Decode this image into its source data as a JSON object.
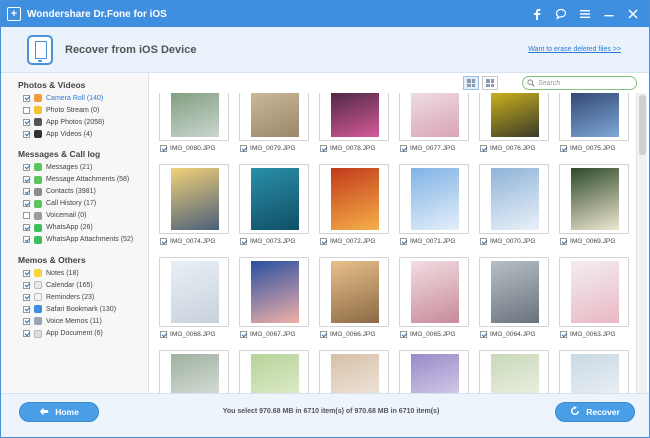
{
  "window": {
    "title": "Wondershare Dr.Fone for iOS"
  },
  "header": {
    "title": "Recover from iOS Device",
    "erase_link": "Want to erase deleted files >>"
  },
  "search": {
    "placeholder": "Search"
  },
  "sidebar": {
    "groups": [
      {
        "title": "Photos & Videos",
        "items": [
          {
            "label": "Camera Roll (140)",
            "checked": true,
            "active": true,
            "icon": "camera-roll-icon",
            "color": "#f39c3c"
          },
          {
            "label": "Photo Stream (0)",
            "checked": false,
            "icon": "photo-stream-icon",
            "color": "#f1c232"
          },
          {
            "label": "App Photos (2058)",
            "checked": true,
            "icon": "app-photos-icon",
            "color": "#555555"
          },
          {
            "label": "App Videos (4)",
            "checked": true,
            "icon": "app-videos-icon",
            "color": "#333333"
          }
        ]
      },
      {
        "title": "Messages & Call log",
        "items": [
          {
            "label": "Messages (21)",
            "checked": true,
            "icon": "messages-icon",
            "color": "#5cc45c"
          },
          {
            "label": "Message Attachments (58)",
            "checked": true,
            "icon": "message-attachments-icon",
            "color": "#5cc45c"
          },
          {
            "label": "Contacts (3981)",
            "checked": true,
            "icon": "contacts-icon",
            "color": "#8c8c8c"
          },
          {
            "label": "Call History (17)",
            "checked": true,
            "icon": "call-history-icon",
            "color": "#5cc45c"
          },
          {
            "label": "Voicemail (0)",
            "checked": false,
            "icon": "voicemail-icon",
            "color": "#9a9a9a"
          },
          {
            "label": "WhatsApp (26)",
            "checked": true,
            "icon": "whatsapp-icon",
            "color": "#3fbf5a"
          },
          {
            "label": "WhatsApp Attachments (52)",
            "checked": true,
            "icon": "whatsapp-attachments-icon",
            "color": "#3fbf5a"
          }
        ]
      },
      {
        "title": "Memos & Others",
        "items": [
          {
            "label": "Notes (18)",
            "checked": true,
            "icon": "notes-icon",
            "color": "#f5d33c"
          },
          {
            "label": "Calendar (165)",
            "checked": true,
            "icon": "calendar-icon",
            "color": "#e8e8e8"
          },
          {
            "label": "Reminders (23)",
            "checked": true,
            "icon": "reminders-icon",
            "color": "#f4f4f4"
          },
          {
            "label": "Safari Bookmark (130)",
            "checked": true,
            "icon": "safari-bookmark-icon",
            "color": "#3b8fe0"
          },
          {
            "label": "Voice Memos (11)",
            "checked": true,
            "icon": "voice-memos-icon",
            "color": "#9aa5b5"
          },
          {
            "label": "App Document (6)",
            "checked": true,
            "icon": "app-document-icon",
            "color": "#dddddd"
          }
        ]
      }
    ]
  },
  "photos": [
    {
      "name": "IMG_0080.JPG",
      "colors": [
        "#6e8f6a",
        "#c9d6cf"
      ]
    },
    {
      "name": "IMG_0079.JPG",
      "colors": [
        "#d8c7a6",
        "#9a8868"
      ]
    },
    {
      "name": "IMG_0078.JPG",
      "colors": [
        "#2a1a2e",
        "#d65a9a"
      ]
    },
    {
      "name": "IMG_0077.JPG",
      "colors": [
        "#f4ecef",
        "#d9a3b8"
      ]
    },
    {
      "name": "IMG_0076.JPG",
      "colors": [
        "#f4d21a",
        "#3a3a2a"
      ]
    },
    {
      "name": "IMG_0075.JPG",
      "colors": [
        "#1c2d55",
        "#7fa8d8"
      ]
    },
    {
      "name": "IMG_0074.JPG",
      "colors": [
        "#f2d17a",
        "#4a5f7a"
      ]
    },
    {
      "name": "IMG_0073.JPG",
      "colors": [
        "#2a8fa8",
        "#0f4f66"
      ]
    },
    {
      "name": "IMG_0072.JPG",
      "colors": [
        "#c23a1a",
        "#f5b04a"
      ]
    },
    {
      "name": "IMG_0071.JPG",
      "colors": [
        "#7fb3e6",
        "#e4eef8"
      ]
    },
    {
      "name": "IMG_0070.JPG",
      "colors": [
        "#8fb3d8",
        "#e9f1f8"
      ]
    },
    {
      "name": "IMG_0069.JPG",
      "colors": [
        "#2e4a2a",
        "#f0e7d2"
      ]
    },
    {
      "name": "IMG_0068.JPG",
      "colors": [
        "#e9eff5",
        "#c8d2dc"
      ]
    },
    {
      "name": "IMG_0067.JPG",
      "colors": [
        "#2a4fa0",
        "#f0b0a8"
      ]
    },
    {
      "name": "IMG_0066.JPG",
      "colors": [
        "#e8c08a",
        "#8c6a45"
      ]
    },
    {
      "name": "IMG_0065.JPG",
      "colors": [
        "#f2dde2",
        "#c78a9a"
      ]
    },
    {
      "name": "IMG_0064.JPG",
      "colors": [
        "#b7bfc6",
        "#6a737c"
      ]
    },
    {
      "name": "IMG_0063.JPG",
      "colors": [
        "#f3eef0",
        "#e9b7c4"
      ]
    },
    {
      "name": "",
      "colors": [
        "#9fb0a0",
        "#e6ece6"
      ]
    },
    {
      "name": "",
      "colors": [
        "#b8d39a",
        "#e8f2d6"
      ]
    },
    {
      "name": "",
      "colors": [
        "#d7c0a8",
        "#f5efe8"
      ]
    },
    {
      "name": "",
      "colors": [
        "#9a88c8",
        "#e6e0f2"
      ]
    },
    {
      "name": "",
      "colors": [
        "#c9d8b8",
        "#f4f7ee"
      ]
    },
    {
      "name": "",
      "colors": [
        "#c9d8e3",
        "#f4f7fa"
      ]
    }
  ],
  "footer": {
    "home_label": "Home",
    "recover_label": "Recover",
    "status": "You select 970.68 MB in 6710 item(s) of 970.68 MB in 6710 item(s)"
  }
}
